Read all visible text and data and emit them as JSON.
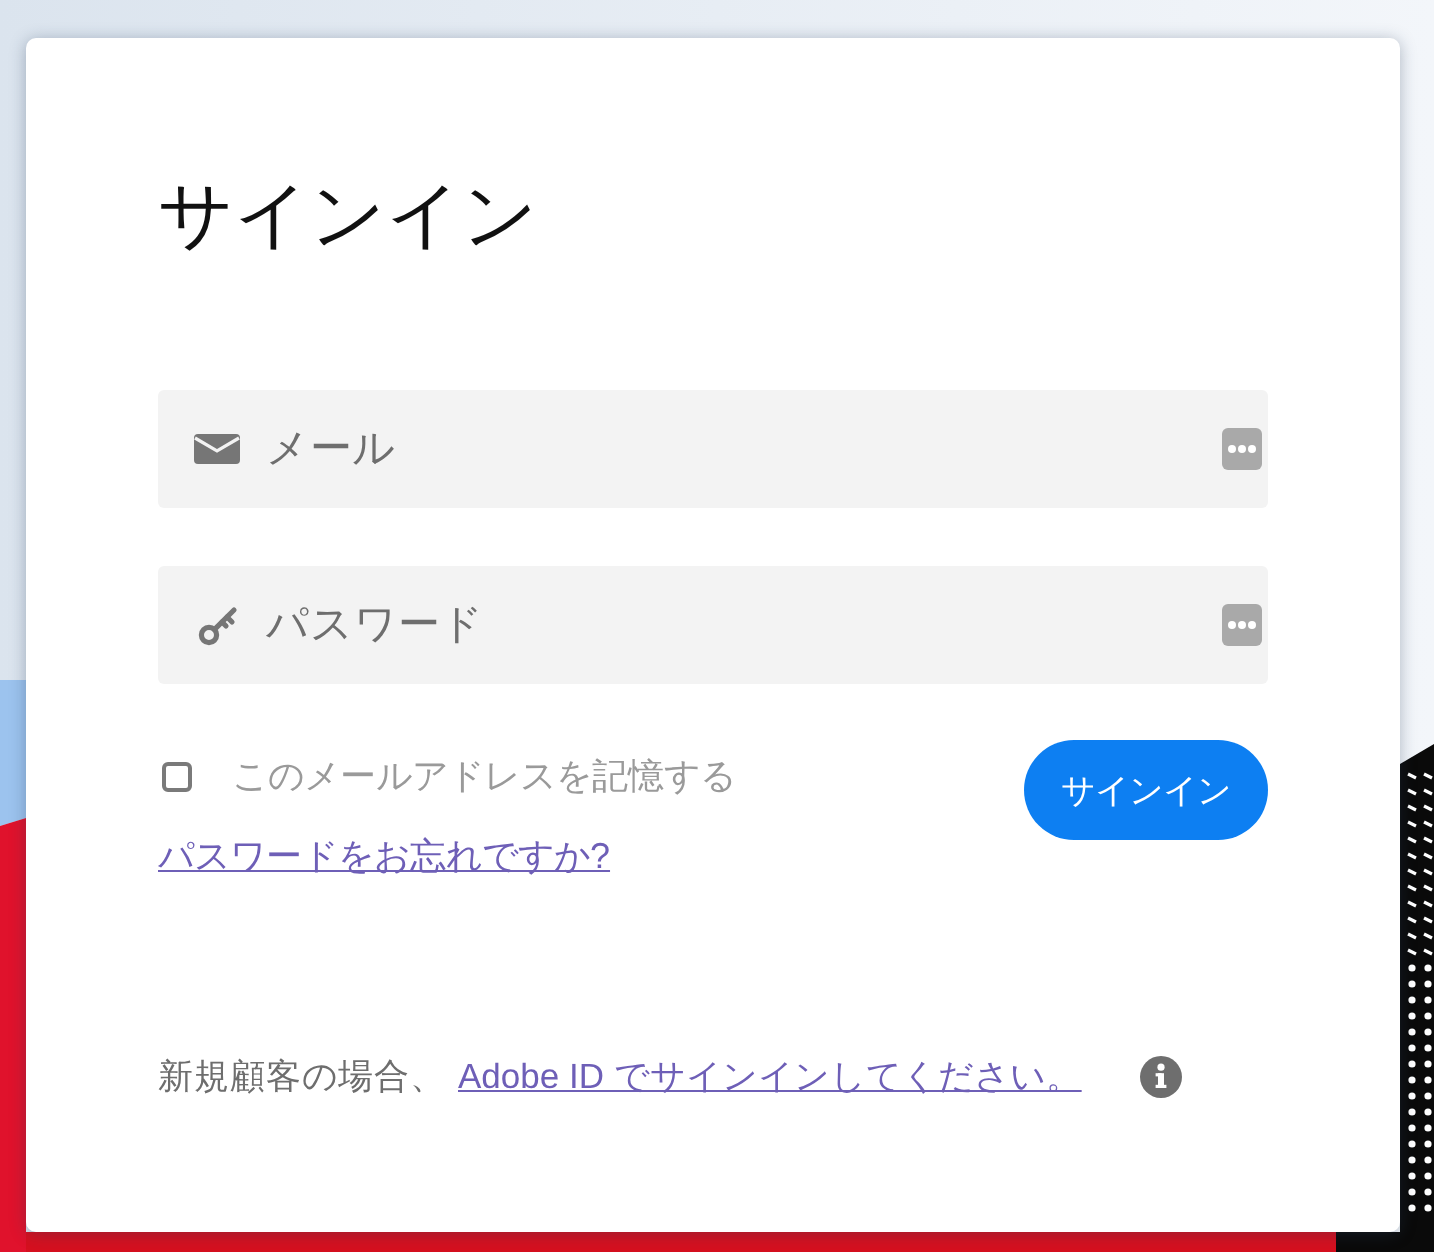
{
  "title": "サインイン",
  "fields": [
    {
      "kind": "email",
      "placeholder": "メール"
    },
    {
      "kind": "password",
      "placeholder": "パスワード"
    }
  ],
  "remember": {
    "label": "このメールアドレスを記憶する",
    "checked": false
  },
  "forgot_link": "パスワードをお忘れですか?",
  "submit_button": "サインイン",
  "footer": {
    "text": "新規顧客の場合、",
    "link": "Adobe ID でサインインしてください。"
  }
}
